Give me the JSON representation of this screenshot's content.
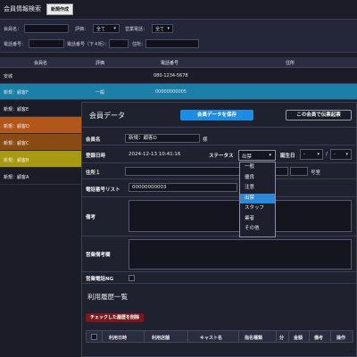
{
  "search": {
    "title": "会員情報検索",
    "new_button": "新規作成",
    "labels": {
      "member_name": "会員名：",
      "rating": "評価：",
      "sales_phone": "営業電話：",
      "phone_number": "電話番号：",
      "phone_last4": "電話番号（下４桁）：",
      "address": "住所："
    },
    "rating_value": "全て",
    "sales_phone_value": "全て"
  },
  "results": {
    "headers": [
      "会員名",
      "評価",
      "電話番号",
      "住所"
    ],
    "rows": [
      {
        "name": "安城",
        "rating": "",
        "phone": "080-1234-5678",
        "address": ""
      },
      {
        "name": "新規：顧客F",
        "rating": "一般",
        "phone": "00000000005",
        "address": ""
      }
    ]
  },
  "left_list": [
    {
      "name": "新規：顧客E",
      "color": "#1b1c28"
    },
    {
      "name": "新規：顧客D",
      "color": "#b2561a"
    },
    {
      "name": "新規：顧客C",
      "color": "#8a4a14"
    },
    {
      "name": "新規：顧客B",
      "color": "#a89a10"
    },
    {
      "name": "新規：顧客A",
      "color": "#1b1c28"
    }
  ],
  "modal": {
    "title": "会員データ",
    "save_button": "会員データを保存",
    "mail_button": "この会員で伝票起票",
    "fields": {
      "member_name_label": "会員名",
      "member_name_value": "新規：顧客D",
      "member_name_suffix": "様",
      "registered_label": "登録日時",
      "registered_value": "2024-12-13 10:41:16",
      "status_label": "ステータス",
      "status_value": "出禁",
      "birthday_label": "誕生日",
      "birthday_month": "-",
      "birthday_day": "-",
      "birthday_sep": "/",
      "address_label": "住所１",
      "room_suffix": "号室",
      "phone_list_label": "電話番号リスト",
      "phone_list_value": "00000000003",
      "notes_label": "備考",
      "sales_notes_label": "営業備考欄",
      "sales_ng_label": "営業電話NG"
    },
    "status_options": [
      "一般",
      "優良",
      "注意",
      "出禁",
      "スタッフ",
      "業者",
      "その他"
    ],
    "status_selected_index": 3,
    "history": {
      "title": "利用履歴一覧",
      "delete_button": "チェックした履歴を削除",
      "columns": [
        "利用日時",
        "利用店舗",
        "キャスト名",
        "指名種類",
        "分",
        "金額",
        "備考",
        "操作"
      ]
    }
  }
}
